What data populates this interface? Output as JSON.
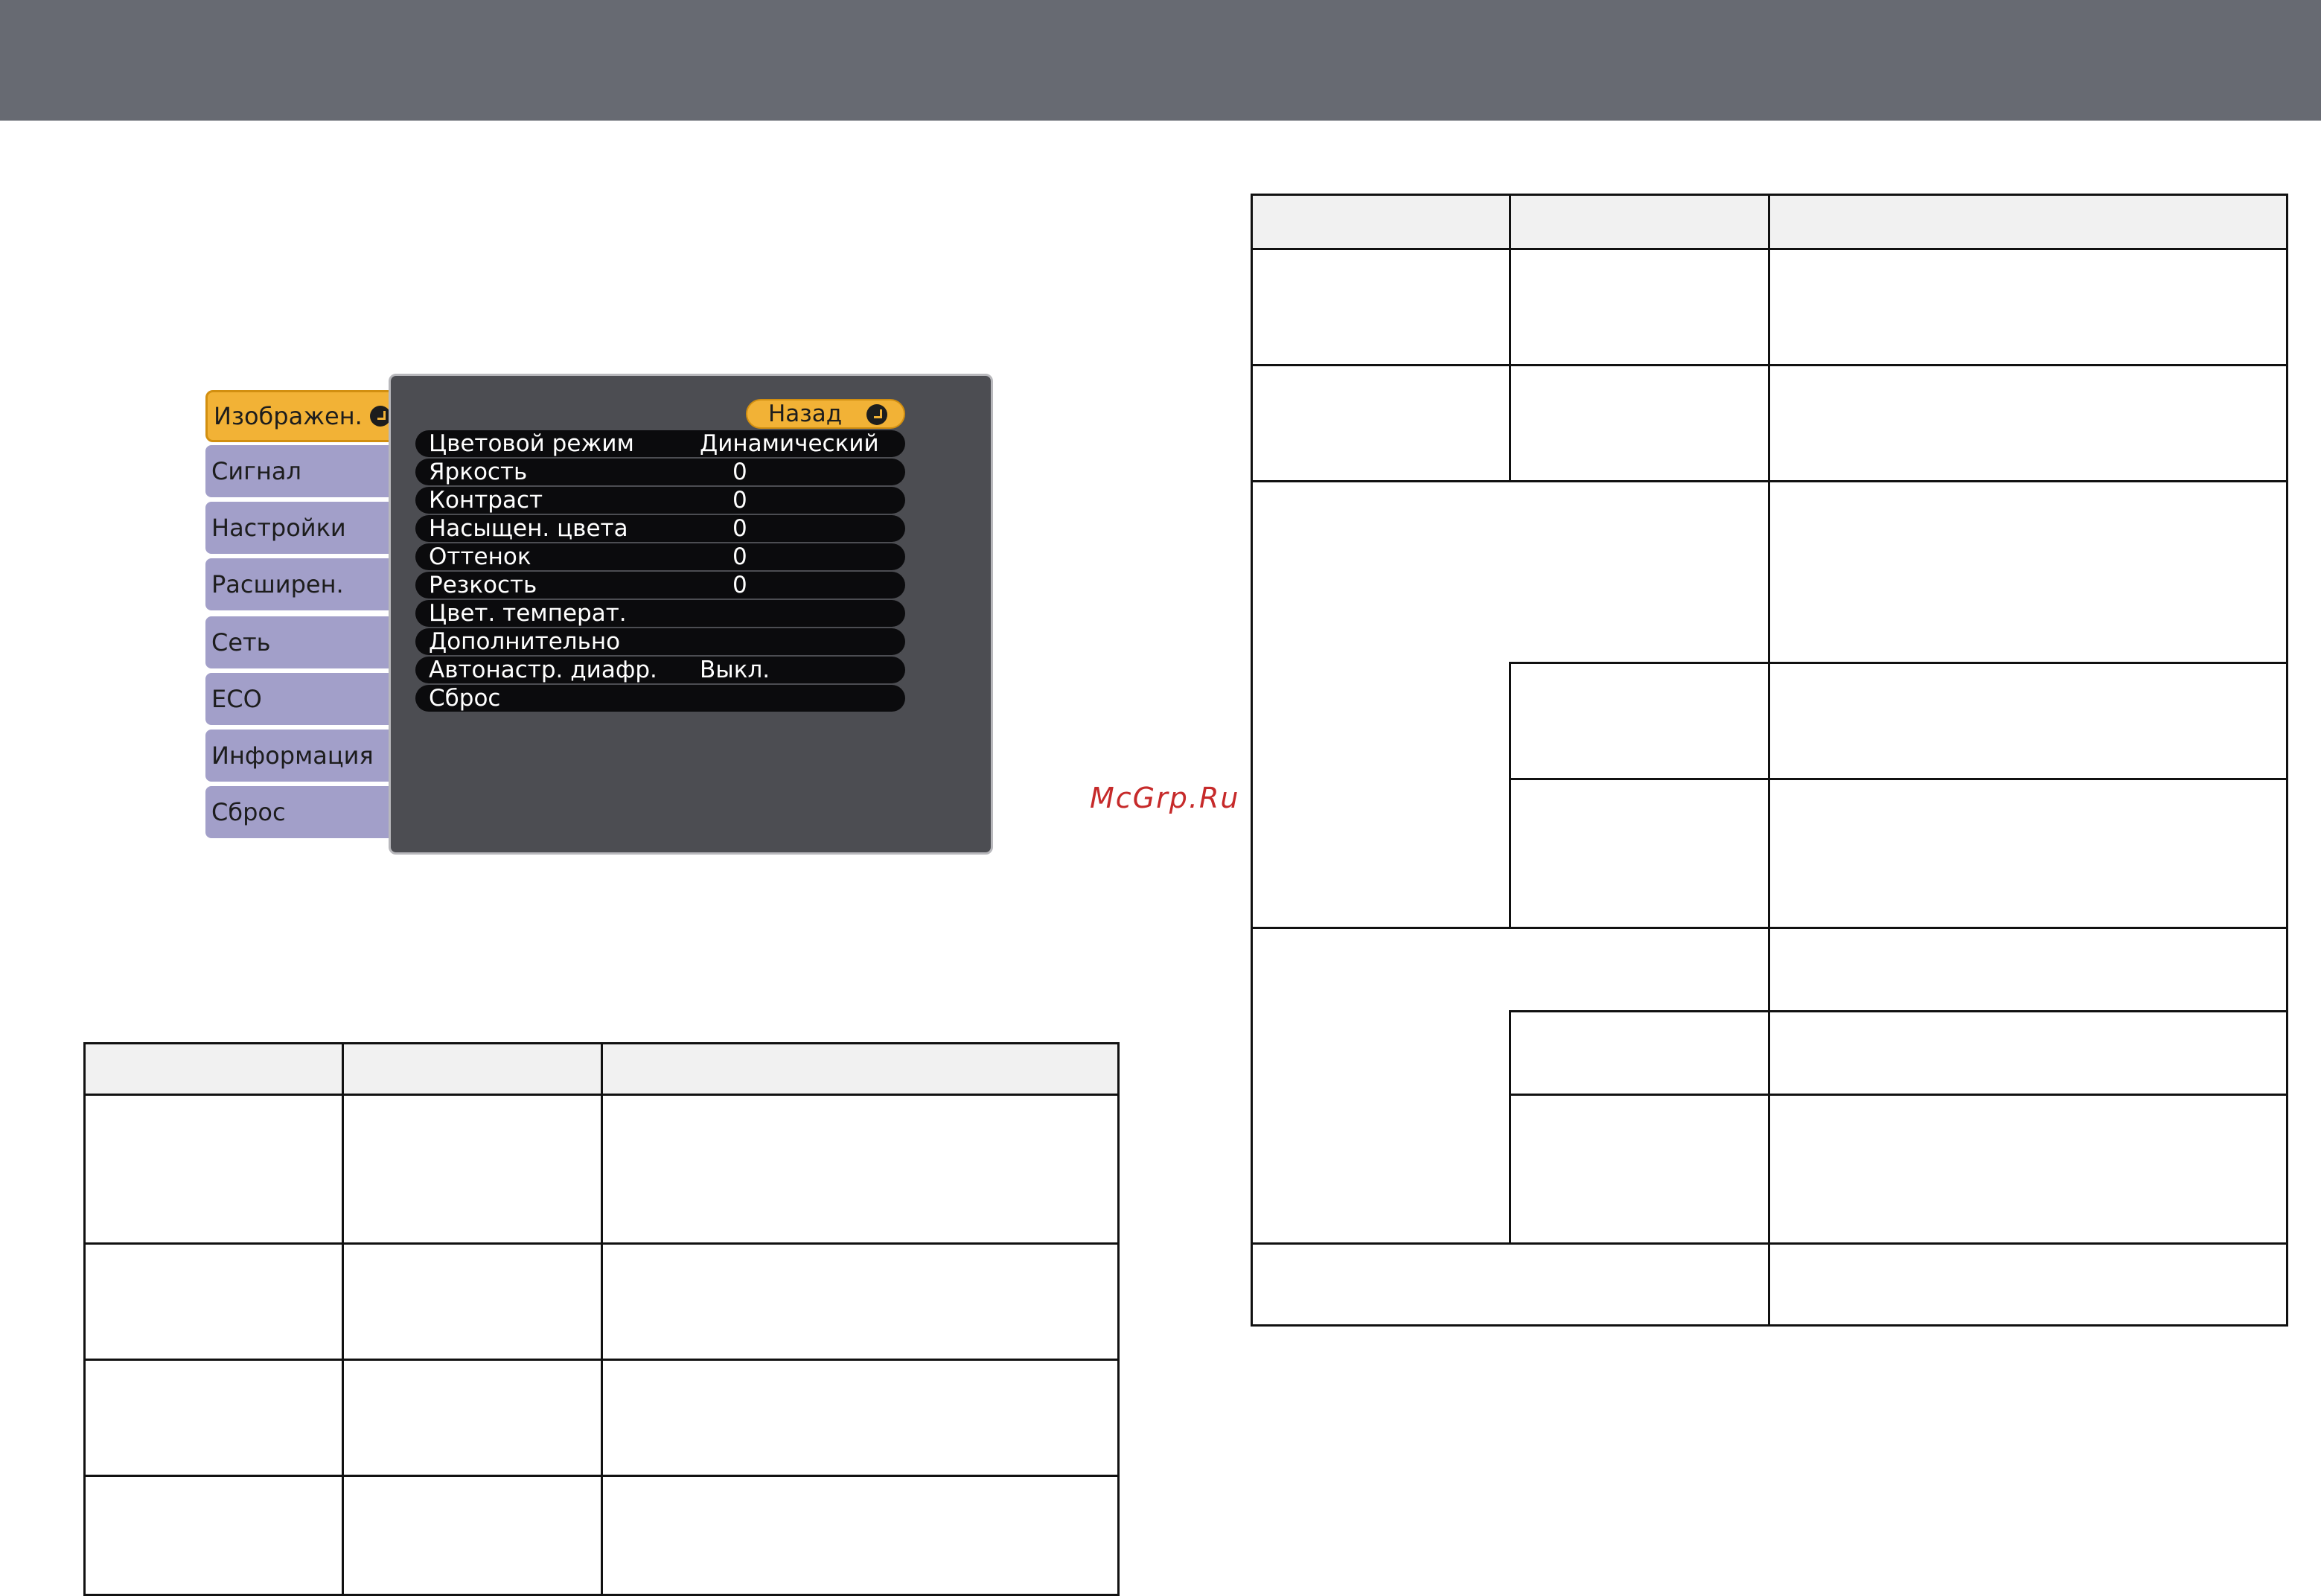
{
  "menu": {
    "tabs": [
      {
        "label": "Изображен.",
        "active": true
      },
      {
        "label": "Сигнал"
      },
      {
        "label": "Настройки"
      },
      {
        "label": "Расширен."
      },
      {
        "label": "Сеть"
      },
      {
        "label": "ECO"
      },
      {
        "label": "Информация"
      },
      {
        "label": "Сброс"
      }
    ],
    "back_label": "Назад",
    "items": [
      {
        "label": "Цветовой режим",
        "value": "Динамический"
      },
      {
        "label": "Яркость",
        "value": "0"
      },
      {
        "label": "Контраст",
        "value": "0"
      },
      {
        "label": "Насыщен. цвета",
        "value": "0"
      },
      {
        "label": "Оттенок",
        "value": "0"
      },
      {
        "label": "Резкость",
        "value": "0"
      },
      {
        "label": "Цвет. температ.",
        "value": ""
      },
      {
        "label": "Дополнительно",
        "value": ""
      },
      {
        "label": "Автонастр. диафр.",
        "value": "Выкл."
      },
      {
        "label": "Сброс",
        "value": ""
      }
    ]
  },
  "watermark": "McGrp.Ru"
}
